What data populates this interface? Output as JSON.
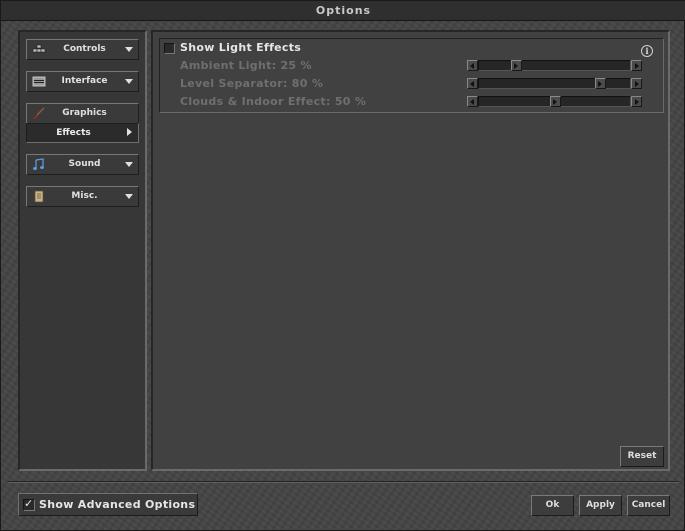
{
  "window": {
    "title": "Options"
  },
  "sidebar": {
    "items": [
      {
        "label": "Controls",
        "icon": "controls-icon"
      },
      {
        "label": "Interface",
        "icon": "interface-icon"
      },
      {
        "label": "Graphics",
        "icon": "graphics-brush-icon",
        "expanded": true
      },
      {
        "label": "Sound",
        "icon": "sound-note-icon"
      },
      {
        "label": "Misc.",
        "icon": "misc-scroll-icon"
      }
    ],
    "subitem": {
      "label": "Effects",
      "selected": true
    }
  },
  "effects": {
    "show_light_effects": {
      "label": "Show Light Effects",
      "checked": false
    },
    "options": [
      {
        "label": "Ambient Light: 25 %",
        "value": 25,
        "enabled": false
      },
      {
        "label": "Level Separator: 80 %",
        "value": 80,
        "enabled": false
      },
      {
        "label": "Clouds & Indoor Effect: 50 %",
        "value": 50,
        "enabled": false
      }
    ],
    "info_glyph": "i"
  },
  "buttons": {
    "reset": "Reset",
    "ok": "Ok",
    "apply": "Apply",
    "cancel": "Cancel"
  },
  "footer": {
    "show_advanced": {
      "label": "Show Advanced Options",
      "checked": true,
      "check_glyph": "✓"
    }
  }
}
